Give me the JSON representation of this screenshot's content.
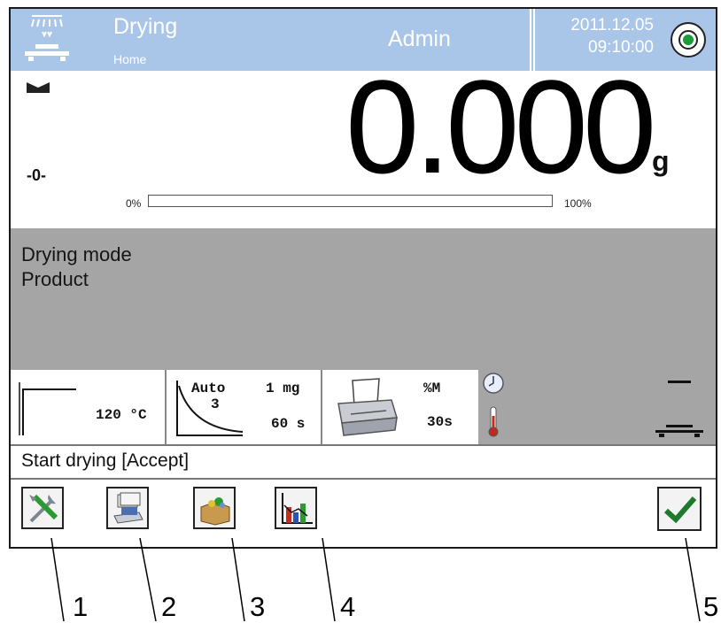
{
  "header": {
    "title": "Drying",
    "subtitle": "Home",
    "user": "Admin",
    "date": "2011.12.05",
    "time": "09:10:00",
    "logo_icon": "balance-drying-icon",
    "status_icon": "target-status-icon",
    "color_bg": "#a9c6e8"
  },
  "weighing": {
    "stability_icon": "stable-icon",
    "zero_indicator": "-0-",
    "value": "0.000",
    "unit": "g",
    "bar_min": "0%",
    "bar_max": "100%",
    "bar_fill_fraction": 0
  },
  "info": {
    "line1": "Drying mode",
    "line2": "Product"
  },
  "tiles": {
    "profile_temp": "120 °C",
    "finish_mode": "Auto",
    "finish_num": "3",
    "finish_mass": "1 mg",
    "finish_time": "60 s",
    "print_unit": "%M",
    "print_interval": "30s"
  },
  "message": "Start drying [Accept]",
  "toolbar": {
    "settings_icon": "tools-icon",
    "database_icon": "database-icon",
    "product_icon": "product-box-icon",
    "report_icon": "chart-icon",
    "accept_icon": "checkmark-icon"
  },
  "callouts": [
    "1",
    "2",
    "3",
    "4",
    "5"
  ]
}
